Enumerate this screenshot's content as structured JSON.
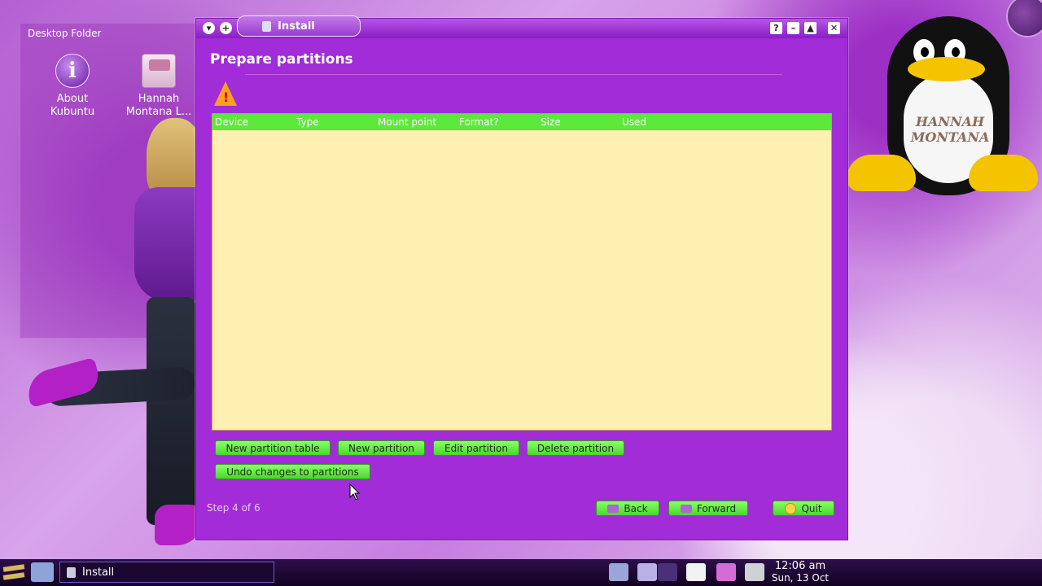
{
  "desktop": {
    "folder_title": "Desktop Folder",
    "icons": [
      {
        "label": "About\nKubuntu",
        "icon": "info-icon"
      },
      {
        "label": "Hannah\nMontana L...",
        "icon": "hannah-montana-disc-icon"
      }
    ],
    "penguin_logo_text": "HANNAH MONTANA"
  },
  "window": {
    "title": "Install",
    "heading": "Prepare partitions",
    "table": {
      "columns": [
        "Device",
        "Type",
        "Mount point",
        "Format?",
        "Size",
        "Used"
      ],
      "rows": []
    },
    "buttons": {
      "new_table": "New partition table",
      "new_partition": "New partition",
      "edit_partition": "Edit partition",
      "delete_partition": "Delete partition",
      "undo": "Undo changes to partitions",
      "back": "Back",
      "forward": "Forward",
      "quit": "Quit"
    },
    "step_text": "Step 4 of 6"
  },
  "taskbar": {
    "task_label": "Install",
    "clock_time": "12:06 am",
    "clock_date": "Sun, 13 Oct"
  },
  "colors": {
    "window_bg": "#a12cd8",
    "table_header": "#5be93a",
    "table_body": "#fdf0b0",
    "button_bg": "#6ef04c"
  }
}
